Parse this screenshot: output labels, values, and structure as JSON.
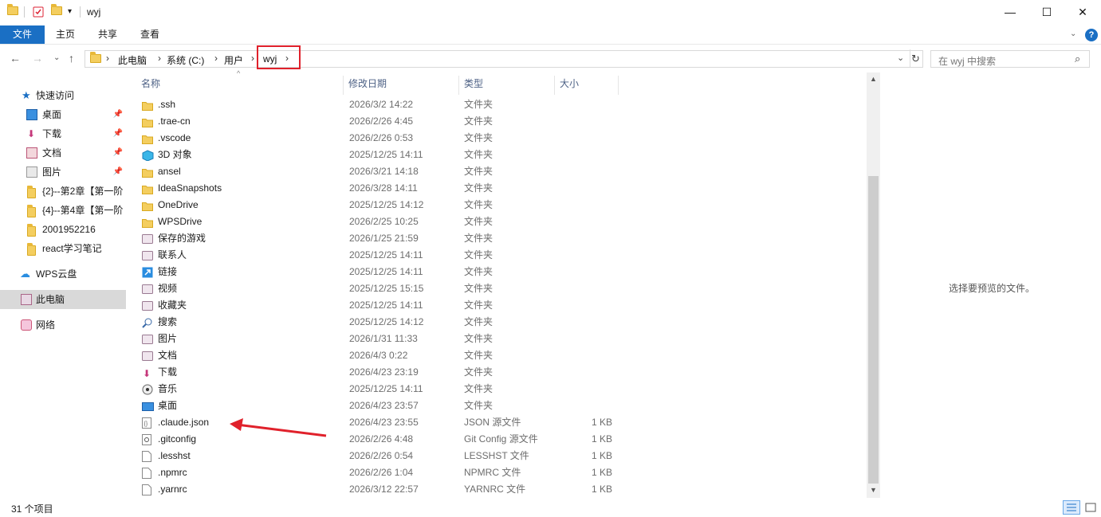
{
  "window": {
    "title": "wyj"
  },
  "ribbon": {
    "tabs": [
      "文件",
      "主页",
      "共享",
      "查看"
    ]
  },
  "address": {
    "crumbs": [
      "此电脑",
      "系统 (C:)",
      "用户",
      "wyj"
    ]
  },
  "search": {
    "placeholder": "在 wyj 中搜索"
  },
  "nav": {
    "quick_access": "快速访问",
    "items": [
      "桌面",
      "下载",
      "文档",
      "图片",
      "{2}--第2章【第一阶",
      "{4}--第4章【第一阶",
      "2001952216",
      "react学习笔记"
    ],
    "wps": "WPS云盘",
    "this_pc": "此电脑",
    "network": "网络"
  },
  "columns": {
    "name": "名称",
    "date": "修改日期",
    "type": "类型",
    "size": "大小"
  },
  "files": [
    {
      "name": ".ssh",
      "date": "2026/3/2 14:22",
      "type": "文件夹",
      "size": "",
      "icon": "folder"
    },
    {
      "name": ".trae-cn",
      "date": "2026/2/26 4:45",
      "type": "文件夹",
      "size": "",
      "icon": "folder"
    },
    {
      "name": ".vscode",
      "date": "2026/2/26 0:53",
      "type": "文件夹",
      "size": "",
      "icon": "folder"
    },
    {
      "name": "3D 对象",
      "date": "2025/12/25 14:11",
      "type": "文件夹",
      "size": "",
      "icon": "3d"
    },
    {
      "name": "ansel",
      "date": "2026/3/21 14:18",
      "type": "文件夹",
      "size": "",
      "icon": "folder"
    },
    {
      "name": "IdeaSnapshots",
      "date": "2026/3/28 14:11",
      "type": "文件夹",
      "size": "",
      "icon": "folder"
    },
    {
      "name": "OneDrive",
      "date": "2025/12/25 14:12",
      "type": "文件夹",
      "size": "",
      "icon": "folder"
    },
    {
      "name": "WPSDrive",
      "date": "2026/2/25 10:25",
      "type": "文件夹",
      "size": "",
      "icon": "folder"
    },
    {
      "name": "保存的游戏",
      "date": "2026/1/25 21:59",
      "type": "文件夹",
      "size": "",
      "icon": "games"
    },
    {
      "name": "联系人",
      "date": "2025/12/25 14:11",
      "type": "文件夹",
      "size": "",
      "icon": "contacts"
    },
    {
      "name": "链接",
      "date": "2025/12/25 14:11",
      "type": "文件夹",
      "size": "",
      "icon": "links"
    },
    {
      "name": "视频",
      "date": "2025/12/25 15:15",
      "type": "文件夹",
      "size": "",
      "icon": "video"
    },
    {
      "name": "收藏夹",
      "date": "2025/12/25 14:11",
      "type": "文件夹",
      "size": "",
      "icon": "favorites"
    },
    {
      "name": "搜索",
      "date": "2025/12/25 14:12",
      "type": "文件夹",
      "size": "",
      "icon": "search"
    },
    {
      "name": "图片",
      "date": "2026/1/31 11:33",
      "type": "文件夹",
      "size": "",
      "icon": "pictures"
    },
    {
      "name": "文档",
      "date": "2026/4/3 0:22",
      "type": "文件夹",
      "size": "",
      "icon": "documents"
    },
    {
      "name": "下载",
      "date": "2026/4/23 23:19",
      "type": "文件夹",
      "size": "",
      "icon": "downloads"
    },
    {
      "name": "音乐",
      "date": "2025/12/25 14:11",
      "type": "文件夹",
      "size": "",
      "icon": "music"
    },
    {
      "name": "桌面",
      "date": "2026/4/23 23:57",
      "type": "文件夹",
      "size": "",
      "icon": "desktop"
    },
    {
      "name": ".claude.json",
      "date": "2026/4/23 23:55",
      "type": "JSON 源文件",
      "size": "1 KB",
      "icon": "json"
    },
    {
      "name": ".gitconfig",
      "date": "2026/2/26 4:48",
      "type": "Git Config 源文件",
      "size": "1 KB",
      "icon": "gear-file"
    },
    {
      "name": ".lesshst",
      "date": "2026/2/26 0:54",
      "type": "LESSHST 文件",
      "size": "1 KB",
      "icon": "file"
    },
    {
      "name": ".npmrc",
      "date": "2026/2/26 1:04",
      "type": "NPMRC 文件",
      "size": "1 KB",
      "icon": "file"
    },
    {
      "name": ".yarnrc",
      "date": "2026/3/12 22:57",
      "type": "YARNRC 文件",
      "size": "1 KB",
      "icon": "file"
    }
  ],
  "preview": {
    "text": "选择要预览的文件。"
  },
  "status": {
    "count": "31 个项目"
  },
  "colors": {
    "accent": "#1a6fc4",
    "highlight": "#e0212b",
    "folder": "#f4ce5f"
  }
}
